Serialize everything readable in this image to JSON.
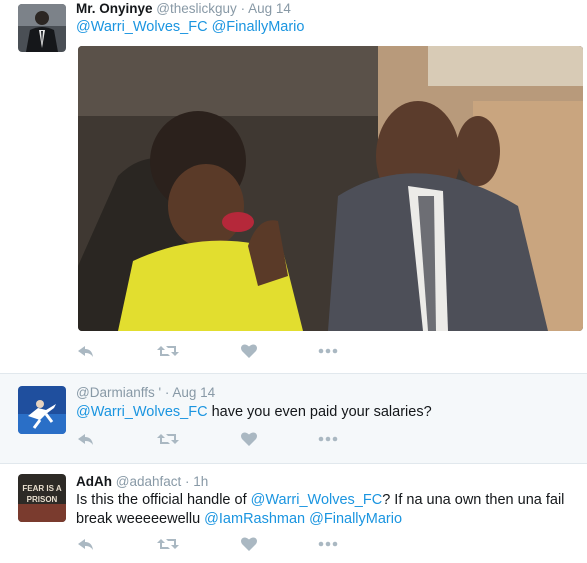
{
  "tweets": [
    {
      "name": "Mr. Onyinye",
      "handle": "@theslickguy",
      "separator": "·",
      "time": "Aug 14",
      "mentions": [
        "@Warri_Wolves_FC",
        "@FinallyMario"
      ]
    },
    {
      "handle": "@Darmianffs '",
      "separator": "·",
      "time": "Aug 14",
      "mention": "@Warri_Wolves_FC",
      "text": " have you even paid your salaries?"
    },
    {
      "name": "AdAh",
      "handle": "@adahfact",
      "separator": "·",
      "time": "1h",
      "line1_prefix": "Is this the official handle of ",
      "line1_mention": "@Warri_Wolves_FC",
      "line1_suffix": "? If na una own then una fail",
      "line2_prefix": "break weeeeewellu ",
      "line2_mention1": "@IamRashman",
      "line2_mention2": "@FinallyMario",
      "avatar_text": [
        "FEAR IS A",
        "PRISON"
      ]
    }
  ],
  "actions": [
    "reply-icon",
    "retweet-icon",
    "like-icon",
    "more-icon"
  ],
  "colors": {
    "mention": "#1b95e0",
    "meta": "#8899a6",
    "action": "#aab8c2",
    "alt_background": "#f5f8fa"
  }
}
